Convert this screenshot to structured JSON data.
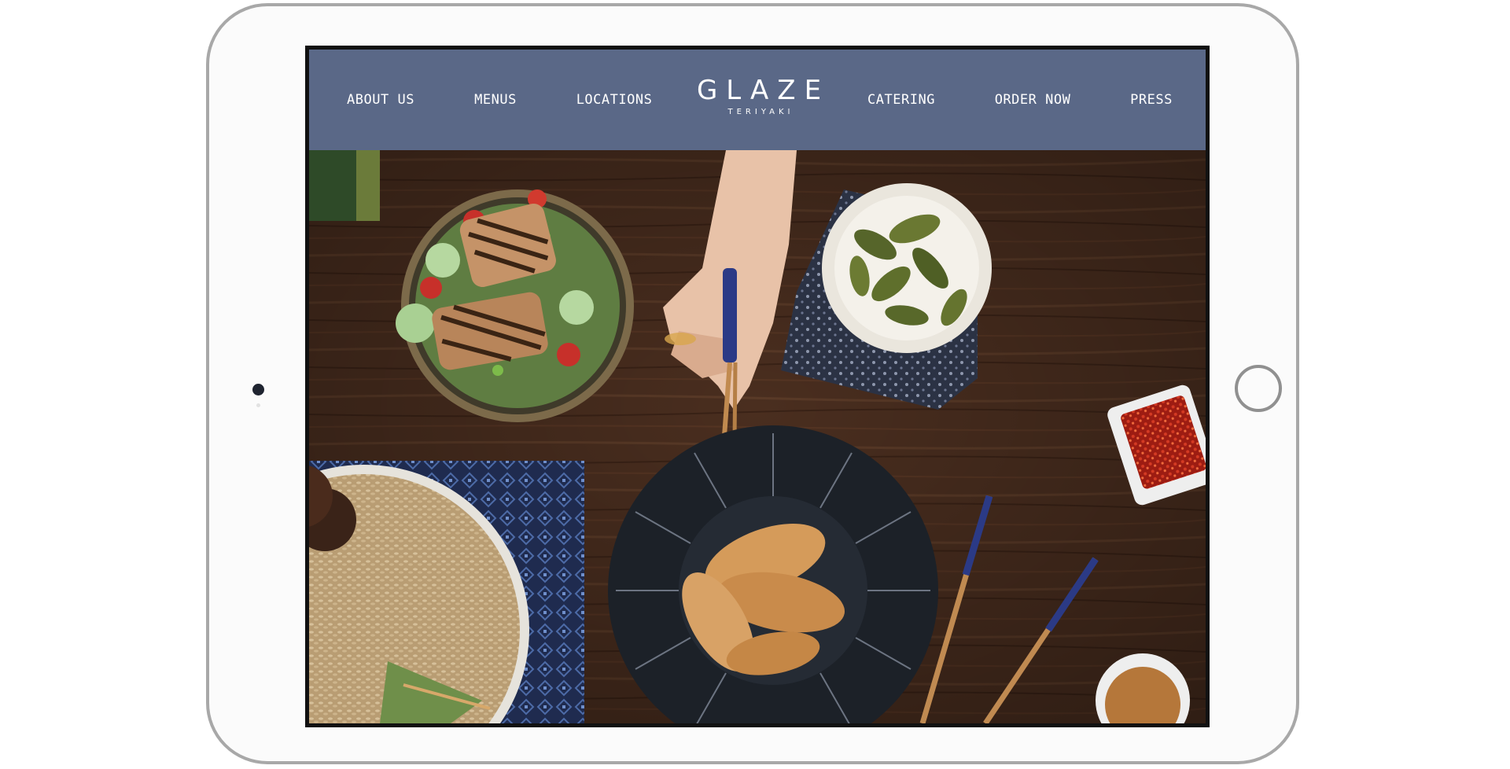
{
  "nav": {
    "left": [
      "ABOUT US",
      "MENUS",
      "LOCATIONS"
    ],
    "right": [
      "CATERING",
      "ORDER NOW",
      "PRESS"
    ]
  },
  "brand": {
    "name": "GLAZE",
    "subtitle": "TERIYAKI"
  },
  "colors": {
    "navbar": "#5a6887",
    "table_wood": "#4a2e1f",
    "nav_text": "#ffffff"
  },
  "icons": [
    "camera-icon",
    "home-button-icon"
  ]
}
